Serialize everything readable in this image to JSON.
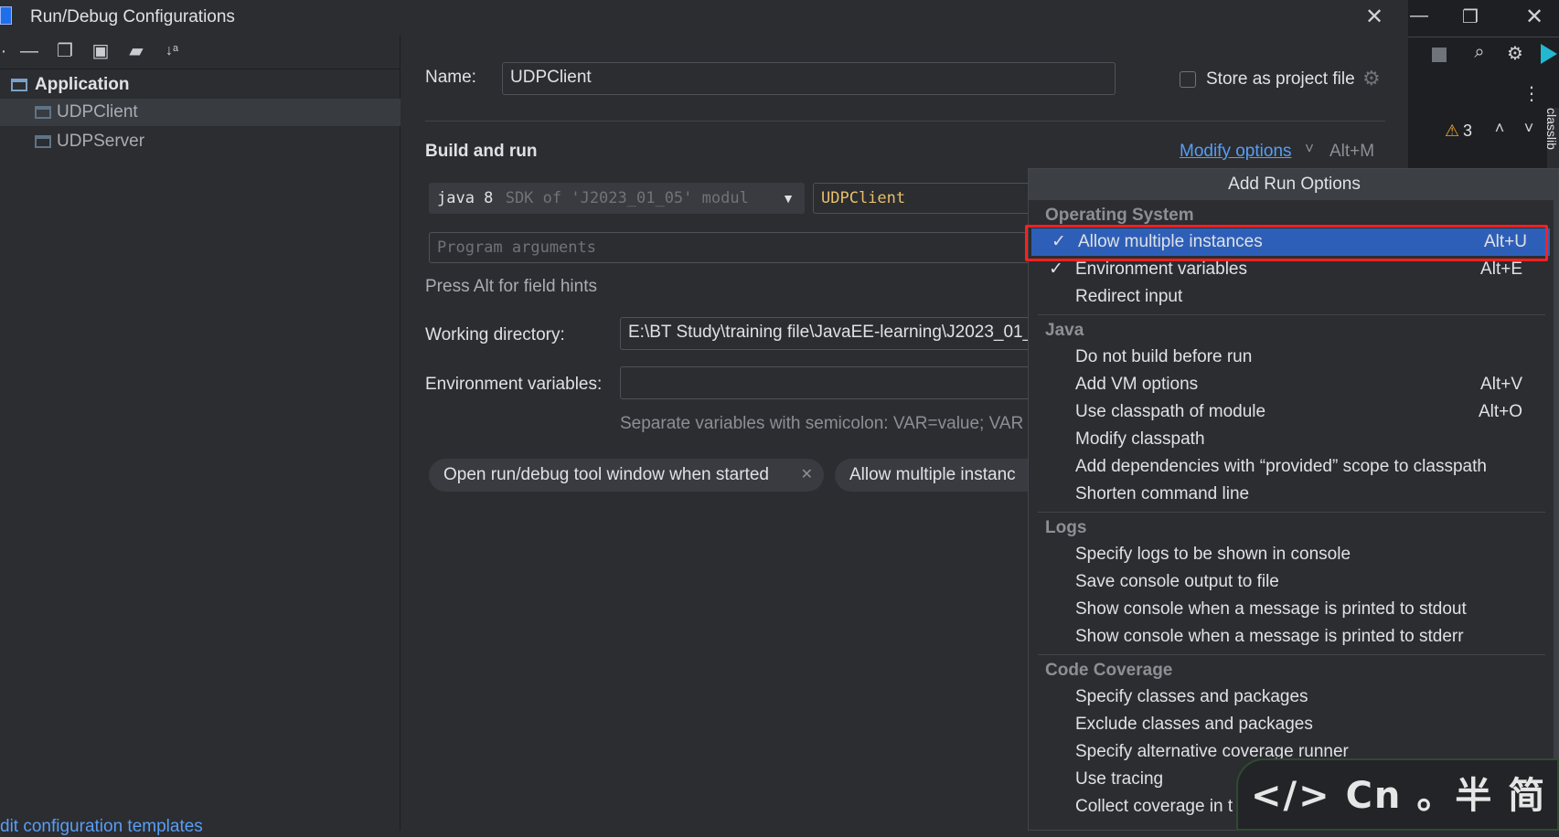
{
  "window": {
    "title": "Run/Debug Configurations"
  },
  "tree": {
    "root": "Application",
    "items": [
      {
        "label": "UDPClient",
        "selected": true
      },
      {
        "label": "UDPServer",
        "selected": false
      }
    ],
    "edit_templates_link": "dit configuration templates"
  },
  "form": {
    "name_label": "Name:",
    "name_value": "UDPClient",
    "store_label": "Store as project file",
    "section_title": "Build and run",
    "modify_options": "Modify options",
    "modify_shortcut": "Alt+M",
    "sdk_value": "java 8",
    "sdk_hint": "SDK of 'J2023_01_05' modul",
    "main_class": "UDPClient",
    "program_args_placeholder": "Program arguments",
    "field_hint": "Press Alt for field hints",
    "workdir_label": "Working directory:",
    "workdir_value": "E:\\BT Study\\training file\\JavaEE-learning\\J2023_01_",
    "env_label": "Environment variables:",
    "env_value": "",
    "env_hint": "Separate variables with semicolon: VAR=value; VAR",
    "chips": [
      {
        "label": "Open run/debug tool window when started"
      },
      {
        "label": "Allow multiple instanc"
      }
    ]
  },
  "popup": {
    "title": "Add Run Options",
    "groups": [
      {
        "name": "Operating System",
        "items": [
          {
            "label": "Allow multiple instances",
            "shortcut": "Alt+U",
            "checked": true,
            "highlighted": true
          },
          {
            "label": "Environment variables",
            "shortcut": "Alt+E",
            "checked": true
          },
          {
            "label": "Redirect input",
            "shortcut": ""
          }
        ]
      },
      {
        "name": "Java",
        "items": [
          {
            "label": "Do not build before run",
            "shortcut": ""
          },
          {
            "label": "Add VM options",
            "shortcut": "Alt+V"
          },
          {
            "label": "Use classpath of module",
            "shortcut": "Alt+O"
          },
          {
            "label": "Modify classpath",
            "shortcut": ""
          },
          {
            "label": "Add dependencies with “provided” scope to classpath",
            "shortcut": ""
          },
          {
            "label": "Shorten command line",
            "shortcut": ""
          }
        ]
      },
      {
        "name": "Logs",
        "items": [
          {
            "label": "Specify logs to be shown in console",
            "shortcut": ""
          },
          {
            "label": "Save console output to file",
            "shortcut": ""
          },
          {
            "label": "Show console when a message is printed to stdout",
            "shortcut": ""
          },
          {
            "label": "Show console when a message is printed to stderr",
            "shortcut": ""
          }
        ]
      },
      {
        "name": "Code Coverage",
        "items": [
          {
            "label": "Specify classes and packages",
            "shortcut": ""
          },
          {
            "label": "Exclude classes and packages",
            "shortcut": ""
          },
          {
            "label": "Specify alternative coverage runner",
            "shortcut": ""
          },
          {
            "label": "Use tracing",
            "shortcut": ""
          },
          {
            "label": "Collect coverage in t",
            "shortcut": ""
          }
        ]
      }
    ]
  },
  "ide": {
    "warning_count": "3",
    "side_tab": "classlib"
  },
  "watermark": {
    "text": "</> Cn 。半 简"
  },
  "colors": {
    "accent": "#2e5fb8",
    "highlight_border": "#ff1f1f",
    "link": "#589df6",
    "main_class": "#e8bf6a"
  }
}
